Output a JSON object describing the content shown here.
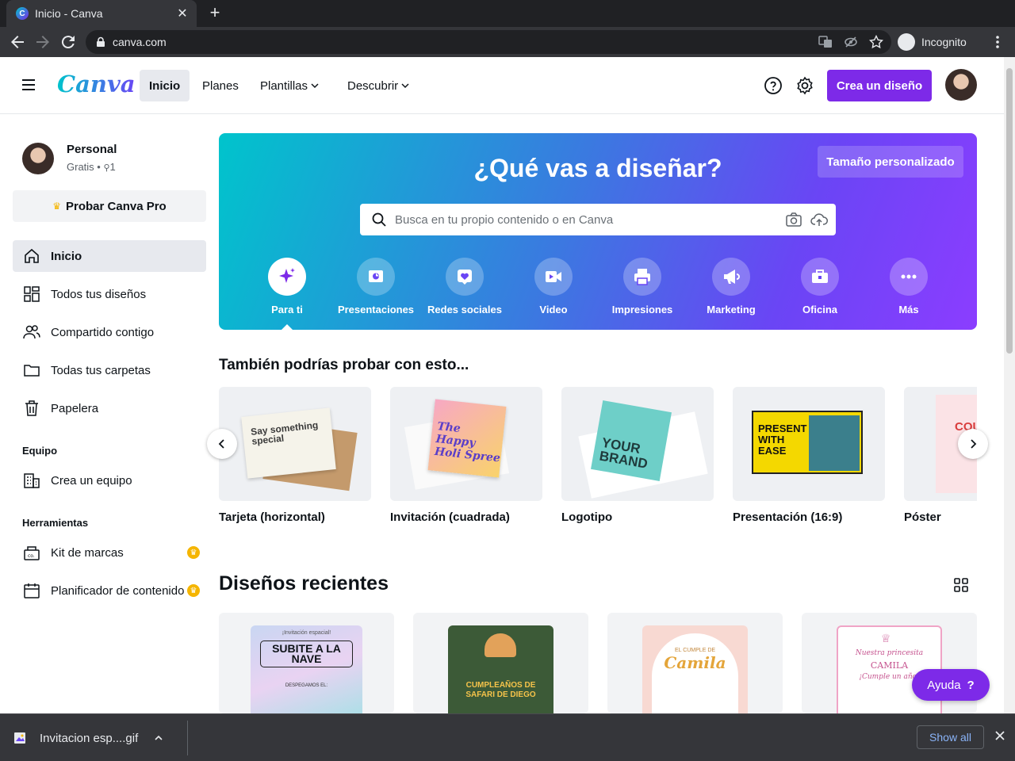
{
  "browser": {
    "tab_title": "Inicio - Canva",
    "tab_close": "✕",
    "new_tab": "+",
    "url": "canva.com",
    "incognito_label": "Incognito"
  },
  "header": {
    "logo": "Canva",
    "nav": [
      {
        "label": "Inicio",
        "active": true
      },
      {
        "label": "Planes"
      },
      {
        "label": "Plantillas",
        "dropdown": true
      },
      {
        "label": "Descubrir",
        "dropdown": true
      }
    ],
    "create_label": "Crea un diseño",
    "brand_color": "#7d2ae8"
  },
  "sidebar": {
    "profile_name": "Personal",
    "profile_meta": "Gratis • ",
    "member_count": "1",
    "pro_label": "Probar Canva Pro",
    "items": [
      {
        "label": "Inicio",
        "icon": "home-icon"
      },
      {
        "label": "Todos tus diseños",
        "icon": "grid-icon"
      },
      {
        "label": "Compartido contigo",
        "icon": "users-icon"
      },
      {
        "label": "Todas tus carpetas",
        "icon": "folder-icon"
      },
      {
        "label": "Papelera",
        "icon": "trash-icon"
      }
    ],
    "team_heading": "Equipo",
    "team_item": "Crea un equipo",
    "tools_heading": "Herramientas",
    "tools": [
      {
        "label": "Kit de marcas",
        "premium": true
      },
      {
        "label": "Planificador de contenido",
        "premium": true
      }
    ]
  },
  "hero": {
    "title": "¿Qué vas a diseñar?",
    "custom_size": "Tamaño personalizado",
    "search_placeholder": "Busca en tu propio contenido o en Canva",
    "categories": [
      {
        "label": "Para ti",
        "icon": "sparkle-icon"
      },
      {
        "label": "Presentaciones",
        "icon": "presentation-icon"
      },
      {
        "label": "Redes sociales",
        "icon": "heart-icon"
      },
      {
        "label": "Video",
        "icon": "video-icon"
      },
      {
        "label": "Impresiones",
        "icon": "printer-icon"
      },
      {
        "label": "Marketing",
        "icon": "megaphone-icon"
      },
      {
        "label": "Oficina",
        "icon": "briefcase-icon"
      },
      {
        "label": "Más",
        "icon": "more-icon"
      }
    ]
  },
  "suggestions": {
    "title": "También podrías probar con esto...",
    "cards": [
      {
        "label": "Tarjeta (horizontal)",
        "art": "Say something special"
      },
      {
        "label": "Invitación (cuadrada)",
        "art": "The Happy Holi Spree"
      },
      {
        "label": "Logotipo",
        "art": "YOUR BRAND"
      },
      {
        "label": "Presentación (16:9)",
        "art": "PRESENT WITH EASE"
      },
      {
        "label": "Póster",
        "art": "COU"
      }
    ]
  },
  "recent": {
    "title": "Diseños recientes",
    "designs": [
      {
        "top": "¡Invitación espacial!",
        "main": "SUBITE A LA NAVE",
        "sub": "DESPEGAMOS EL:"
      },
      {
        "top": "",
        "main": "CUMPLEAÑOS DE SAFARI DE DIEGO",
        "sub": ""
      },
      {
        "top": "EL CUMPLE DE",
        "main": "Camila",
        "sub": ""
      },
      {
        "top": "Nuestra princesita",
        "main": "CAMILA",
        "sub": "¡Cumple un año!"
      }
    ]
  },
  "help_label": "Ayuda",
  "downloads": {
    "file": "Invitacion esp....gif",
    "show_all": "Show all"
  }
}
